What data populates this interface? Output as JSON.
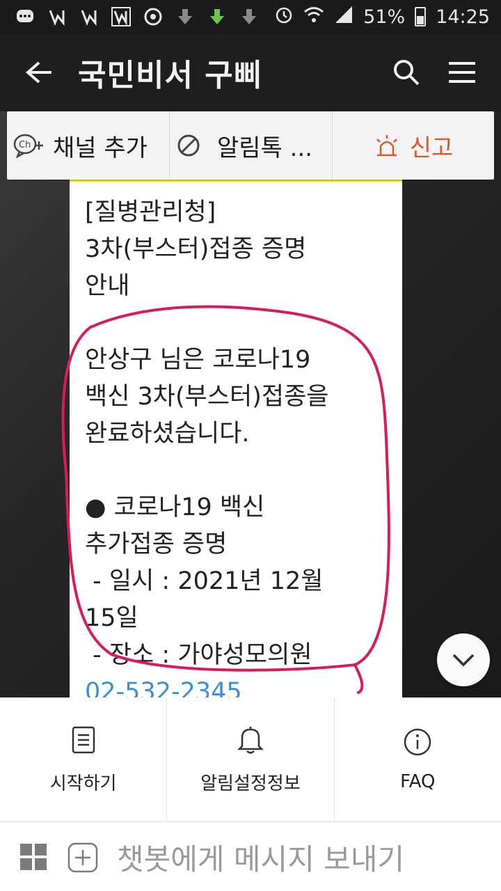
{
  "status_bar": {
    "battery": "51%",
    "time": "14:25"
  },
  "app_bar": {
    "title": "국민비서 구삐"
  },
  "actions": {
    "add_channel": "채널 추가",
    "notice": "알림톡 ...",
    "report": "신고"
  },
  "message": {
    "lines": [
      "[질병관리청]",
      "3차(부스터)접종 증명",
      "안내",
      "",
      "안상구 님은 코로나19",
      "백신 3차(부스터)접종을",
      "완료하셨습니다.",
      "",
      "● 코로나19 백신",
      "추가접종 증명",
      " - 일시 : 2021년 12월",
      "15일",
      " - 장소 : 가야성모의원"
    ],
    "phone": "02-532-2345"
  },
  "menu": {
    "start": "시작하기",
    "notice_info": "알림설정정보",
    "faq": "FAQ"
  },
  "input": {
    "placeholder": "챗봇에게 메시지 보내기"
  },
  "colors": {
    "annotation": "#d81b5a",
    "report": "#e0582a",
    "kakao_yellow": "#f5dd2e",
    "link": "#3c8fd8"
  }
}
